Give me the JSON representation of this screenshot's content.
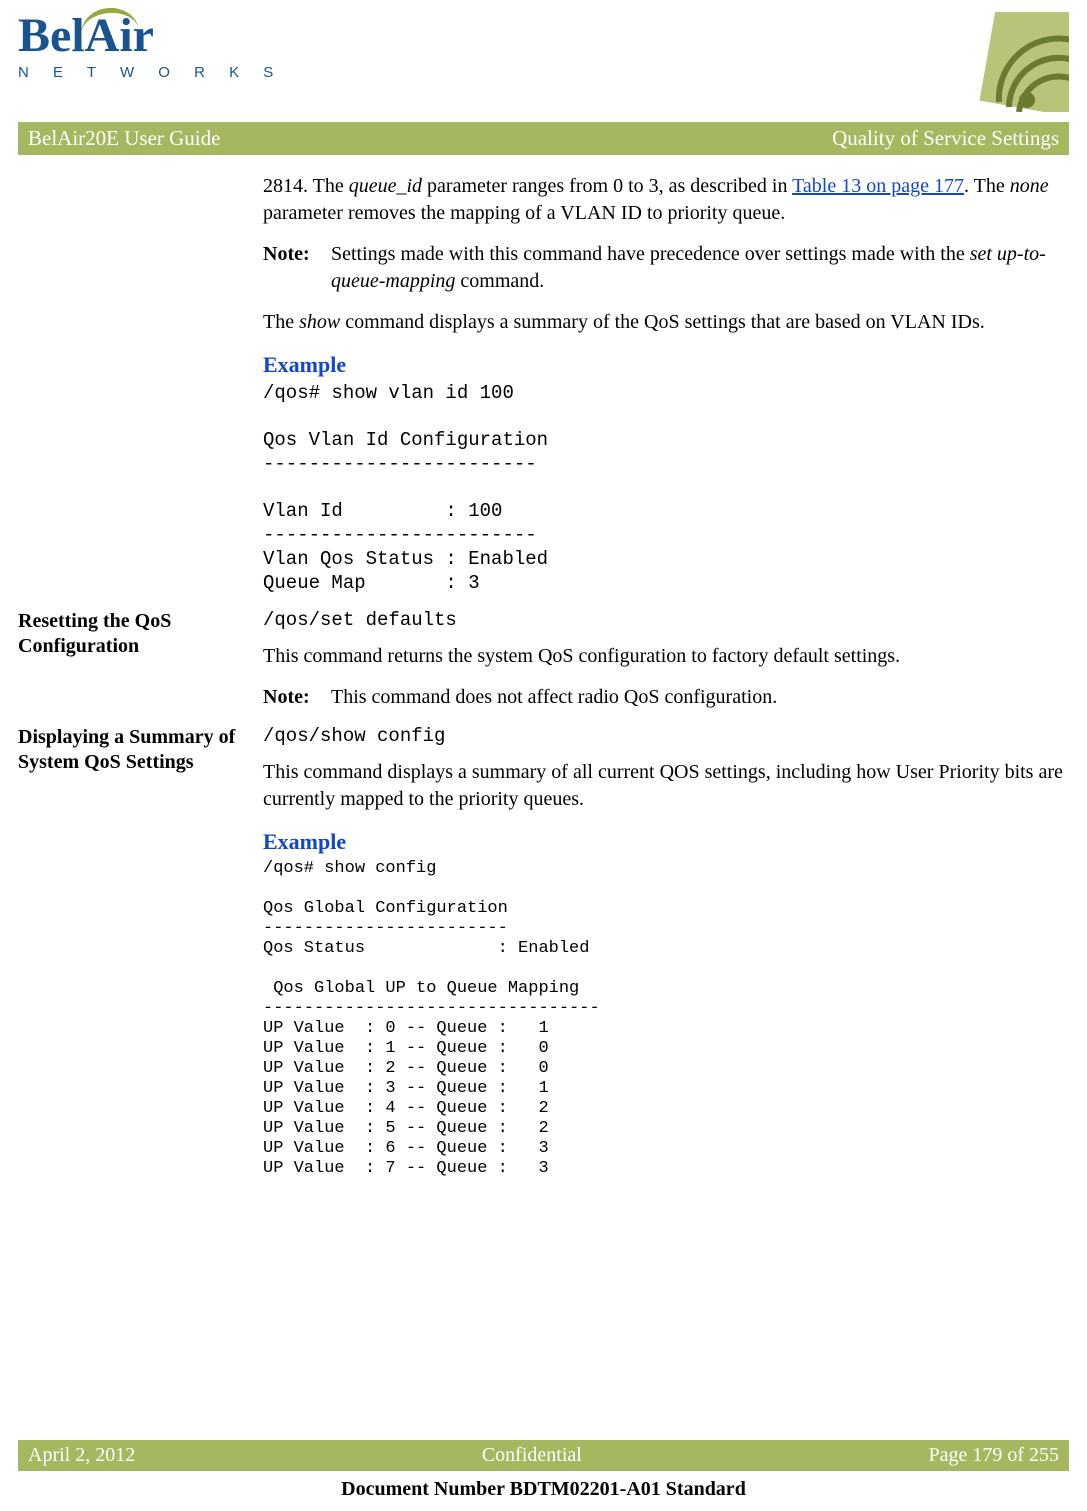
{
  "header": {
    "logo_top": "BelAir",
    "logo_bottom": "N E T W O R K S",
    "title_left": "BelAir20E User Guide",
    "title_right": "Quality of Service Settings"
  },
  "body": {
    "p1_a": "2814. The ",
    "p1_b": "queue_id",
    "p1_c": " parameter ranges from 0 to 3, as described in ",
    "p1_link": "Table 13 on page 177",
    "p1_d": ". The ",
    "p1_e": "none",
    "p1_f": " parameter removes the mapping of a VLAN ID to priority queue.",
    "note1_label": "Note:",
    "note1_a": "Settings made with this command have precedence over settings made with the ",
    "note1_b": "set up-to-queue-mapping",
    "note1_c": " command.",
    "p2_a": "The ",
    "p2_b": "show",
    "p2_c": " command displays a summary of the QoS settings that are based on VLAN IDs.",
    "example_heading": "Example",
    "code1": "/qos# show vlan id 100\n\nQos Vlan Id Configuration\n------------------------\n\nVlan Id         : 100\n------------------------\nVlan Qos Status : Enabled\nQueue Map       : 3",
    "side2": "Resetting the QoS Configuration",
    "code2": "/qos/set defaults",
    "p3": "This command returns the system QoS configuration to factory default settings.",
    "note2_label": "Note:",
    "note2_body": "This command does not affect radio QoS configuration.",
    "side3": "Displaying a Summary of System QoS Settings",
    "code3": "/qos/show config",
    "p4": "This command displays a summary of all current QOS settings, including how User Priority bits are currently mapped to the priority queues.",
    "code4": "/qos# show config\n\nQos Global Configuration\n------------------------\nQos Status             : Enabled\n\n Qos Global UP to Queue Mapping\n---------------------------------\nUP Value  : 0 -- Queue :   1\nUP Value  : 1 -- Queue :   0\nUP Value  : 2 -- Queue :   0\nUP Value  : 3 -- Queue :   1\nUP Value  : 4 -- Queue :   2\nUP Value  : 5 -- Queue :   2\nUP Value  : 6 -- Queue :   3\nUP Value  : 7 -- Queue :   3"
  },
  "footer": {
    "left": "April 2, 2012",
    "center": "Confidential",
    "right": "Page 179 of 255",
    "docnum": "Document Number BDTM02201-A01 Standard"
  }
}
